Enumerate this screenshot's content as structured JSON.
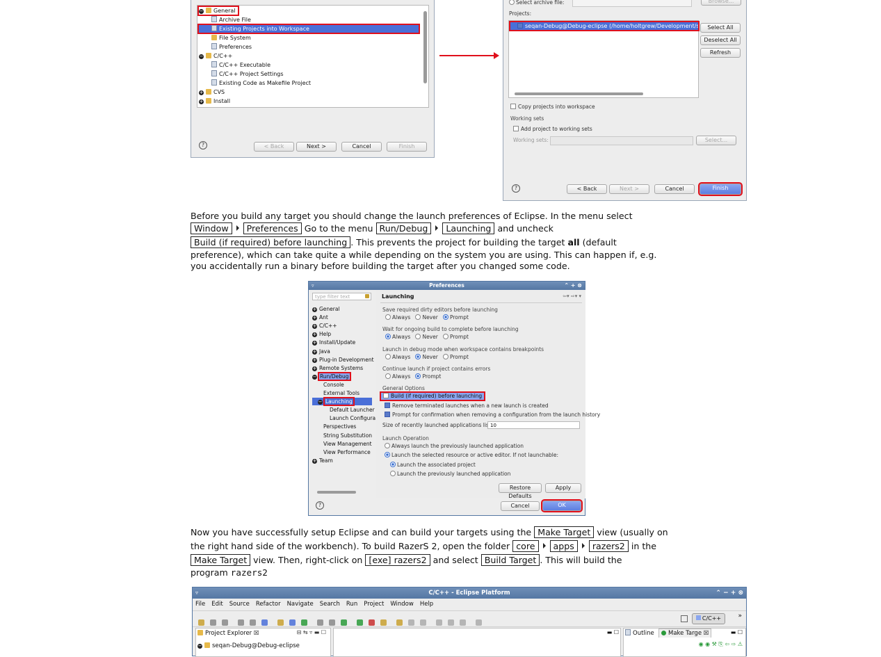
{
  "import_dialog_left": {
    "tree": [
      {
        "label": "General",
        "expanded": true
      },
      {
        "label": "Archive File"
      },
      {
        "label": "Existing Projects into Workspace",
        "selected": true
      },
      {
        "label": "File System"
      },
      {
        "label": "Preferences"
      },
      {
        "label": "C/C++",
        "expanded": true
      },
      {
        "label": "C/C++ Executable"
      },
      {
        "label": "C/C++ Project Settings"
      },
      {
        "label": "Existing Code as Makefile Project"
      },
      {
        "label": "CVS"
      },
      {
        "label": "Install"
      }
    ],
    "buttons": {
      "back": "< Back",
      "next": "Next >",
      "cancel": "Cancel",
      "finish": "Finish"
    }
  },
  "import_dialog_right": {
    "select_archive_label": "Select archive file:",
    "browse": "Browse...",
    "projects_label": "Projects:",
    "project_item": "seqan-Debug@Debug-eclipse (/home/holtgrew/Development/seqan",
    "select_all": "Select All",
    "deselect_all": "Deselect All",
    "refresh": "Refresh",
    "copy_projects": "Copy projects into workspace",
    "working_sets_group": "Working sets",
    "add_to_working_sets": "Add project to working sets",
    "working_sets_label": "Working sets:",
    "select_btn": "Select...",
    "buttons": {
      "back": "< Back",
      "next": "Next >",
      "cancel": "Cancel",
      "finish": "Finish"
    }
  },
  "para1": {
    "t1": "Before you build any target you should change the launch preferences of Eclipse. In the menu select",
    "k_window": "Window",
    "k_preferences": "Preferences",
    "t2": "Go to the menu",
    "k_rundebug": "Run/Debug",
    "k_launching": "Launching",
    "t3": "and uncheck",
    "k_build": "Build (if required) before launching",
    "t4": ". This prevents the project for building the target",
    "bold_all": "all",
    "t5": "(default",
    "line3": "preference), which can take quite a while depending on the system you are using. This can happen if, e.g.",
    "line4": "you accidentally run a binary before building the target after you changed some code."
  },
  "preferences_dialog": {
    "title": "Preferences",
    "filter_placeholder": "type filter text",
    "tree": [
      "General",
      "Ant",
      "C/C++",
      "Help",
      "Install/Update",
      "Java",
      "Plug-in Development",
      "Remote Systems",
      "Run/Debug",
      "Console",
      "External Tools",
      "Launching",
      "Default Launcher",
      "Launch Configura",
      "Perspectives",
      "String Substitution",
      "View Management",
      "View Performance",
      "Team"
    ],
    "page_title": "Launching",
    "save_dirty": "Save required dirty editors before launching",
    "wait_build": "Wait for ongoing build to complete before launching",
    "debug_mode": "Launch in debug mode when workspace contains breakpoints",
    "continue_errors": "Continue launch if project contains errors",
    "opt_always": "Always",
    "opt_never": "Never",
    "opt_prompt": "Prompt",
    "general_options": "General Options",
    "build_before": "Build (if required) before launching",
    "remove_terminated": "Remove terminated launches when a new launch is created",
    "prompt_confirm": "Prompt for confirmation when removing a configuration from the launch history",
    "size_label": "Size of recently launched applications list:",
    "size_value": "10",
    "launch_operation": "Launch Operation",
    "always_prev": "Always launch the previously launched application",
    "launch_selected": "Launch the selected resource or active editor. If not launchable:",
    "launch_assoc": "Launch the associated project",
    "launch_prev": "Launch the previously launched application",
    "restore_defaults": "Restore Defaults",
    "apply": "Apply",
    "cancel": "Cancel",
    "ok": "OK"
  },
  "para2": {
    "t1": "Now you have successfully setup Eclipse and can build your targets using the",
    "k_make_target": "Make Target",
    "t2": "view (usually on",
    "t3": "the right hand side of the workbench). To build RazerS 2, open the folder",
    "k_core": "core",
    "k_apps": "apps",
    "k_razers2": "razers2",
    "t4": "in the",
    "k_make_target2": "Make Target",
    "t5": "view. Then, right-click on",
    "k_exe": "[exe] razers2",
    "t6": "and select",
    "k_build_target": "Build Target",
    "t7": ". This will build the",
    "t8": "program",
    "mono": "razers2"
  },
  "eclipse_window": {
    "title": "C/C++ - Eclipse Platform",
    "menu": [
      "File",
      "Edit",
      "Source",
      "Refactor",
      "Navigate",
      "Search",
      "Run",
      "Project",
      "Window",
      "Help"
    ],
    "perspective": "C/C++",
    "project_explorer": "Project Explorer",
    "project_item": "seqan-Debug@Debug-eclipse",
    "outline": "Outline",
    "make_target": "Make Targe"
  }
}
